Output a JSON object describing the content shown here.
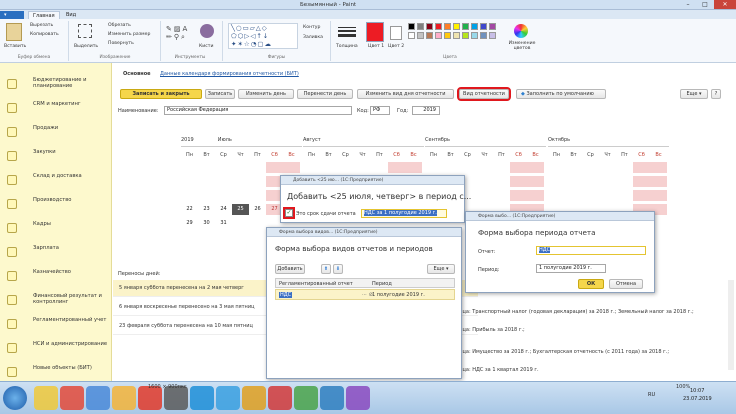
{
  "paint": {
    "title": "Безымянный - Paint",
    "tabs": [
      "Главная",
      "Вид"
    ],
    "file_tab": "",
    "clipboard": {
      "paste": "Вставить",
      "cut": "Вырезать",
      "copy": "Копировать",
      "group": "Буфер обмена"
    },
    "image": {
      "select": "Выделить",
      "crop": "Обрезать",
      "resize": "Изменить размер",
      "rotate": "Повернуть",
      "group": "Изображение"
    },
    "tools": {
      "group": "Инструменты",
      "brushes": "Кисти"
    },
    "shapes": {
      "group": "Фигуры",
      "outline": "Контур",
      "fill": "Заливка"
    },
    "thickness": "Толщина",
    "color1": "Цвет 1",
    "color2": "Цвет 2",
    "colors_group": "Цвета",
    "edit_colors": "Изменение цветов",
    "palette": [
      "#000000",
      "#7f7f7f",
      "#880015",
      "#ed1c24",
      "#ff7f27",
      "#fff200",
      "#22b14c",
      "#00a2e8",
      "#3f48cc",
      "#a349a4",
      "#ffffff",
      "#c3c3c3",
      "#b97a57",
      "#ffaec9",
      "#ffc90e",
      "#efe4b0",
      "#b5e61d",
      "#99d9ea",
      "#7092be",
      "#c8bfe7"
    ],
    "status_size": "1600 × 900пкс",
    "zoom": "100%"
  },
  "sidebar": {
    "items": [
      {
        "label": "Бюджетирование и планирование"
      },
      {
        "label": "CRM и маркетинг"
      },
      {
        "label": "Продажи"
      },
      {
        "label": "Закупки"
      },
      {
        "label": "Склад и доставка"
      },
      {
        "label": "Производство"
      },
      {
        "label": "Кадры"
      },
      {
        "label": "Зарплата"
      },
      {
        "label": "Казначейство"
      },
      {
        "label": "Финансовый результат и контроллинг"
      },
      {
        "label": "Регламентированный учет"
      },
      {
        "label": "НСИ и администрирование"
      },
      {
        "label": "Новые объекты (БИТ)"
      }
    ]
  },
  "form": {
    "tab_main": "Основное",
    "tab_link": "Данные календаря формирования отчетности (БИТ)",
    "save_close": "Записать и закрыть",
    "save": "Записать",
    "change_day": "Изменить день",
    "move_day": "Перенести день",
    "change_kind": "Изменить вид дня отчетности",
    "report_kind": "Вид отчетности",
    "fill_default": "Заполнить по умолчанию",
    "more": "Еще",
    "help": "?",
    "name_label": "Наименование:",
    "name_value": "Российская Федерация",
    "code_label": "Код:",
    "code_value": "РФ",
    "year_label": "Год:",
    "year_value": "2019",
    "transfers_label": "Переносы дней:"
  },
  "calendar": {
    "weekdays": [
      "Пн",
      "Вт",
      "Ср",
      "Чт",
      "Пт",
      "Сб",
      "Вс"
    ],
    "months": [
      {
        "year": "2019",
        "name": "Июль"
      },
      {
        "year": "",
        "name": "Август"
      },
      {
        "year": "",
        "name": "Сентябрь"
      },
      {
        "year": "",
        "name": "Октябрь"
      }
    ],
    "july_rows": [
      [
        "",
        "",
        "",
        "",
        "",
        "",
        ""
      ],
      [
        "",
        "",
        "",
        "",
        "",
        "",
        ""
      ],
      [
        "",
        "",
        "",
        "",
        "",
        "",
        ""
      ],
      [
        "22",
        "23",
        "24",
        "25",
        "26",
        "27",
        "28"
      ],
      [
        "29",
        "30",
        "31",
        "",
        "",
        "",
        ""
      ]
    ]
  },
  "transfers": [
    "5 января суббота перенесена на 2 мая четверг",
    "6 января воскресенье перенесено на 3 мая пятниц",
    "23 февраля суббота перенесена на 10 мая пятниц"
  ],
  "right_texts": [
    "ница: Транспортный налог (годовая декларация) за 2018 г.; Земельный налог за 2018 г.;",
    "ница: Прибыль за 2018 г.;",
    "ница: Имущество за 2018 г.; Бухгалтерская отчетность (с 2011 года) за 2018 г.;",
    "ница: НДС за 1 квартал 2019 г."
  ],
  "dialog_add": {
    "window_title": "Добавить <25 ию... (1С:Предприятие)",
    "heading": "Добавить <25 июля, четверг> в период с...",
    "checkbox_label": "Это срок сдачи отчета",
    "period_value": "НДС за 1 полугодие 2019 г."
  },
  "dialog_kinds": {
    "window_title": "Форма выбора видов... (1С:Предприятие)",
    "heading": "Форма выбора видов отчетов и периодов",
    "add": "Добавить",
    "more": "Еще",
    "col_report": "Регламентированный отчет",
    "col_period": "Период",
    "row_report": "НДС",
    "row_period": "1 полугодие 2019 г."
  },
  "dialog_period": {
    "window_title": "Форма выбо... (1С:Предприятие)",
    "heading": "Форма выбора периода отчета",
    "report_label": "Отчет:",
    "report_value": "НДС",
    "period_label": "Период:",
    "period_value": "1 полугодие 2019 г.",
    "ok": "ОК",
    "cancel": "Отмена"
  },
  "taskbar": {
    "lang": "RU",
    "time": "10:07",
    "date": "23.07.2019"
  }
}
